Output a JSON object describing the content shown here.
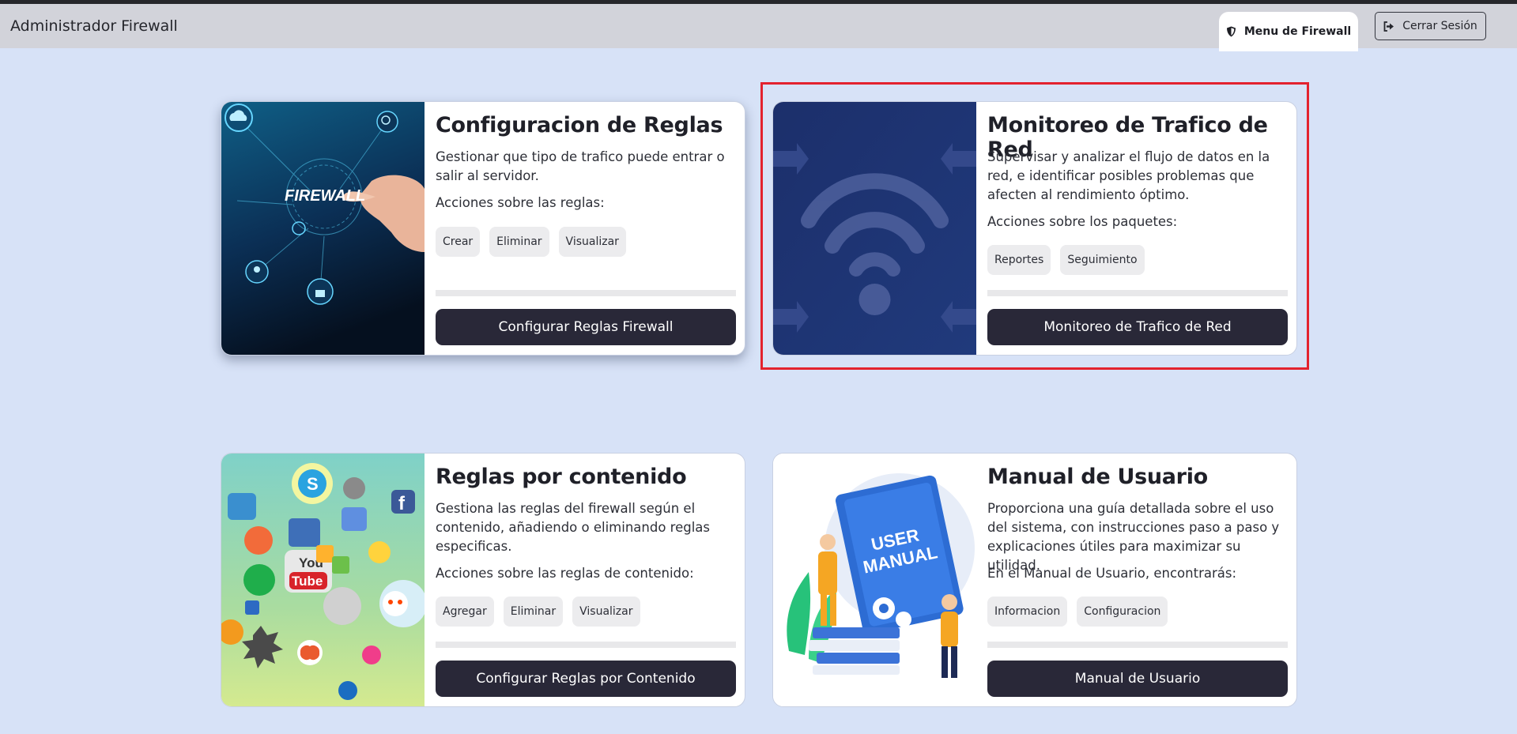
{
  "navbar": {
    "brand": "Administrador Firewall",
    "menu_tab": "Menu de Firewall",
    "logout": "Cerrar Sesión"
  },
  "cards": [
    {
      "title": "Configuracion de Reglas",
      "description": "Gestionar que tipo de trafico puede entrar o salir al servidor.",
      "actions_label": "Acciones sobre las reglas:",
      "chips": [
        "Crear",
        "Eliminar",
        "Visualizar"
      ],
      "button": "Configurar Reglas Firewall",
      "image_text": "FIREWALL"
    },
    {
      "title": "Monitoreo de Trafico de Red",
      "description": "Supervisar y analizar el flujo de datos en la red, e identificar posibles problemas que afecten al rendimiento óptimo.",
      "actions_label": "Acciones sobre los paquetes:",
      "chips": [
        "Reportes",
        "Seguimiento"
      ],
      "button": "Monitoreo de Trafico de Red"
    },
    {
      "title": "Reglas por contenido",
      "description": "Gestiona las reglas del firewall según el contenido, añadiendo o eliminando reglas especificas.",
      "actions_label": "Acciones sobre las reglas de contenido:",
      "chips": [
        "Agregar",
        "Eliminar",
        "Visualizar"
      ],
      "button": "Configurar Reglas por Contenido",
      "image_text": "You Tube"
    },
    {
      "title": "Manual de Usuario",
      "description": "Proporciona una guía detallada sobre el uso del sistema, con instrucciones paso a paso y explicaciones útiles para maximizar su utilidad.",
      "actions_label": "En el Manual de Usuario, encontrarás:",
      "chips": [
        "Informacion",
        "Configuracion"
      ],
      "button": "Manual de Usuario",
      "image_text": "USER MANUAL"
    }
  ],
  "colors": {
    "background": "#d7e2f7",
    "navbar": "#d2d3da",
    "button": "#292838",
    "highlight": "#e3222e"
  }
}
